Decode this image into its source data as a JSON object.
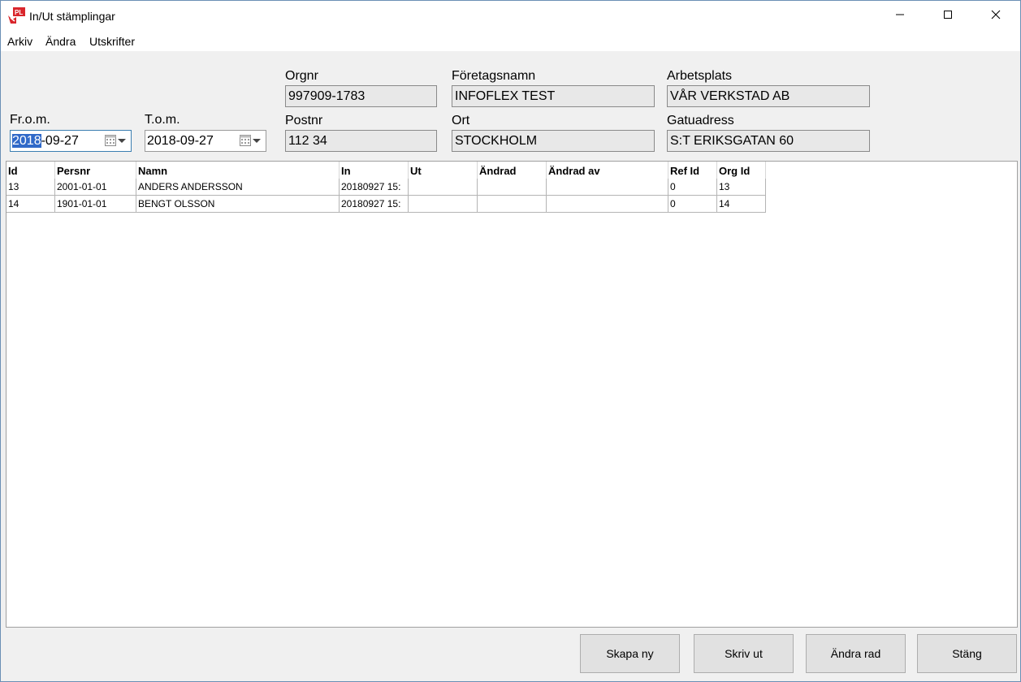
{
  "window": {
    "title": "In/Ut stämplingar",
    "icon": "app-pl-icon",
    "icon_text": "PL",
    "controls": [
      "minimize-icon",
      "maximize-icon",
      "close-icon"
    ]
  },
  "menu": {
    "arkiv": "Arkiv",
    "andra": "Ändra",
    "utskrifter": "Utskrifter"
  },
  "filters": {
    "from_label": "Fr.o.m.",
    "from_value_selected": "2018",
    "from_value_rest": "-09-27",
    "tom_label": "T.o.m.",
    "tom_value": "2018-09-27"
  },
  "company": {
    "orgnr_label": "Orgnr",
    "orgnr_value": "997909-1783",
    "foretagsnamn_label": "Företagsnamn",
    "foretagsnamn_value": "INFOFLEX TEST",
    "arbetsplats_label": "Arbetsplats",
    "arbetsplats_value": "VÅR VERKSTAD AB",
    "postnr_label": "Postnr",
    "postnr_value": "112 34",
    "ort_label": "Ort",
    "ort_value": "STOCKHOLM",
    "gatuadress_label": "Gatuadress",
    "gatuadress_value": "S:T ERIKSGATAN 60"
  },
  "table": {
    "headers": [
      "Id",
      "Persnr",
      "Namn",
      "In",
      "Ut",
      "Ändrad",
      "Ändrad av",
      "Ref Id",
      "Org Id"
    ],
    "rows": [
      [
        "13",
        "2001-01-01",
        "ANDERS ANDERSSON",
        "20180927 15:",
        "",
        "",
        "",
        "0",
        "13"
      ],
      [
        "14",
        "1901-01-01",
        "BENGT OLSSON",
        "20180927 15:",
        "",
        "",
        "",
        "0",
        "14"
      ]
    ]
  },
  "buttons": {
    "skapa_ny": "Skapa ny",
    "skriv_ut": "Skriv ut",
    "andra_rad": "Ändra rad",
    "stang": "Stäng"
  },
  "colors": {
    "selection": "#3069c8",
    "icon_red": "#d9262c",
    "focus_border": "#3c7fb1"
  }
}
